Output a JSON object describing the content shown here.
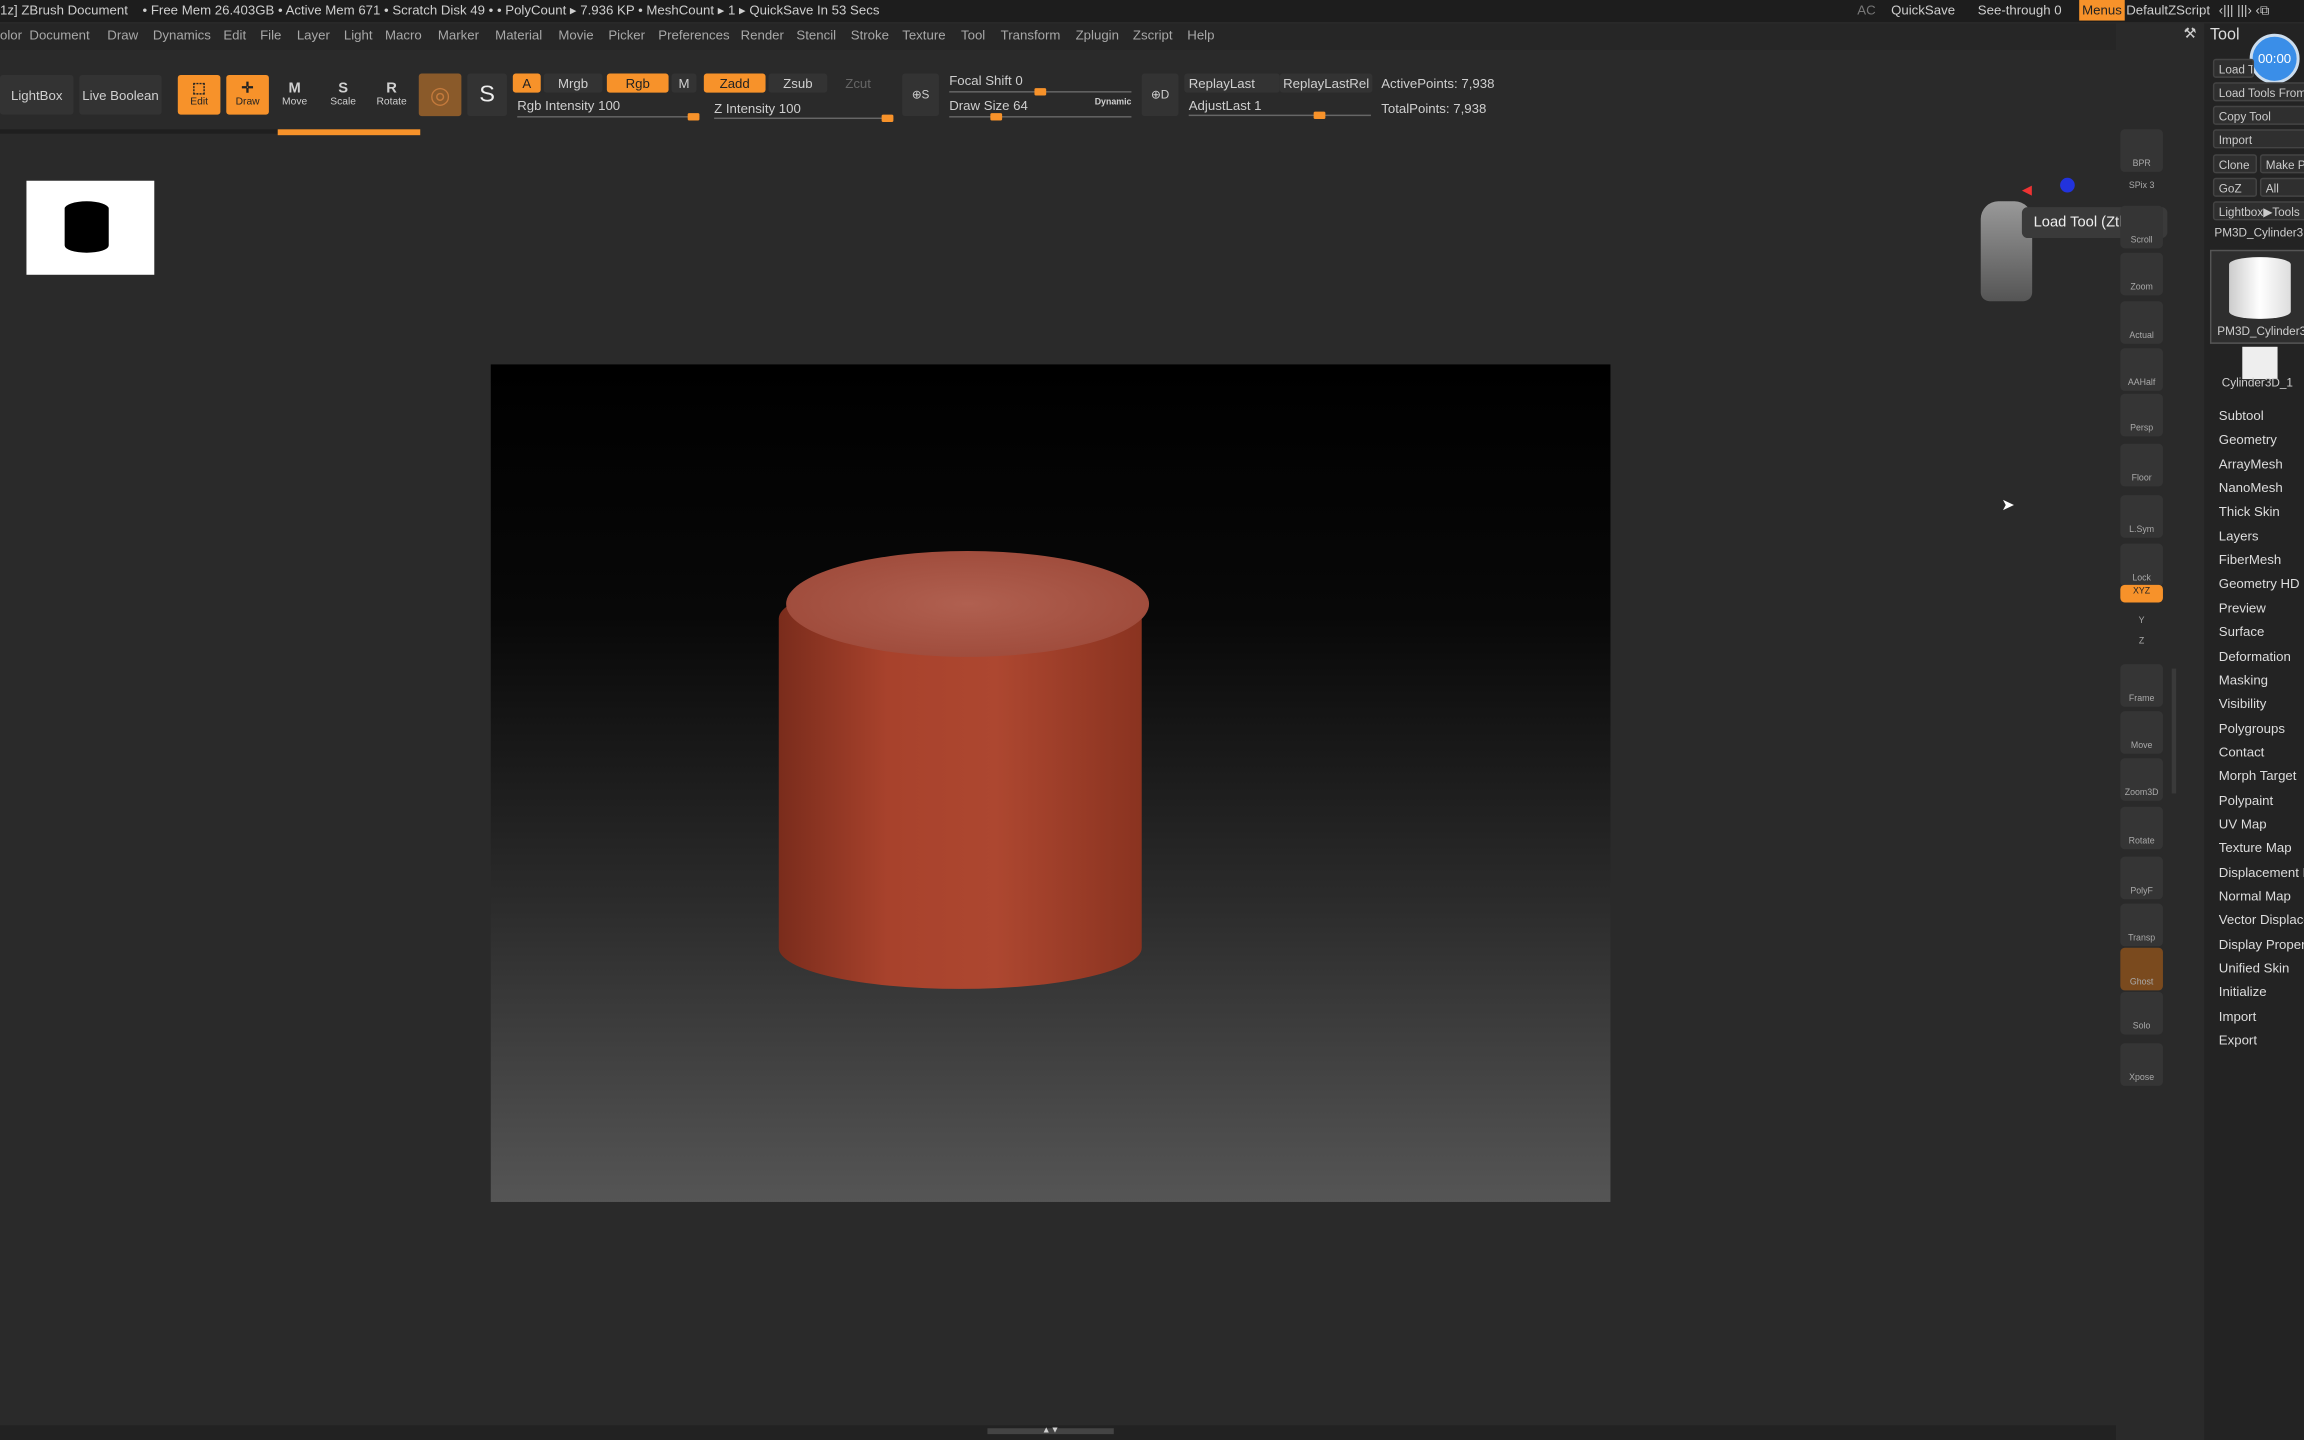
{
  "titlebar": {
    "app": "1z]  ZBrush Document",
    "stats": "• Free Mem 26.403GB • Active Mem 671 • Scratch Disk 49 • • PolyCount ▸ 7.936 KP  • MeshCount ▸ 1  ▸ QuickSave In 53 Secs",
    "ac": "AC",
    "quicksave": "QuickSave",
    "seethrough": "See-through  0",
    "menus": "Menus",
    "zscript": "DefaultZScript"
  },
  "menus": [
    "olor",
    "Document",
    "Draw",
    "Dynamics",
    "Edit",
    "File",
    "Layer",
    "Light",
    "Macro",
    "Marker",
    "Material",
    "Movie",
    "Picker",
    "Preferences",
    "Render",
    "Stencil",
    "Stroke",
    "Texture",
    "Tool",
    "Transform",
    "Zplugin",
    "Zscript",
    "Help"
  ],
  "toolbar": {
    "lightbox": "LightBox",
    "live_boolean": "Live Boolean",
    "edit": "Edit",
    "draw": "Draw",
    "move": "Move",
    "scale": "Scale",
    "rotate": "Rotate",
    "a": "A",
    "mrgb": "Mrgb",
    "rgb": "Rgb",
    "m": "M",
    "zadd": "Zadd",
    "zsub": "Zsub",
    "zcut": "Zcut",
    "rgb_intensity": "Rgb Intensity 100",
    "z_intensity": "Z Intensity 100",
    "focal_shift": "Focal Shift 0",
    "draw_size": "Draw Size 64",
    "dynamic": "Dynamic",
    "replay_last": "ReplayLast",
    "replay_last_rel": "ReplayLastRel",
    "adjust_last": "AdjustLast 1",
    "active_points": "ActivePoints: 7,938",
    "total_points": "TotalPoints: 7,938",
    "s": "S",
    "d": "D"
  },
  "values": {
    "rgb_intensity": 100,
    "z_intensity": 100,
    "focal_shift": 0,
    "draw_size": 64,
    "adjust_last": 1,
    "see_through": 0
  },
  "tooltip": "Load Tool (Ztl File)",
  "shelf": [
    "BPR",
    "SPix 3",
    "Scroll",
    "Zoom",
    "Actual",
    "AAHalf",
    "Persp",
    "Floor",
    "L.Sym",
    "Lock",
    "XYZ",
    "Y",
    "Z",
    "Frame",
    "Move",
    "Zoom3D",
    "Rotate",
    "PolyF",
    "Transp",
    "Ghost",
    "Solo",
    "Xpose"
  ],
  "tool": {
    "title": "Tool",
    "timer": "00:00",
    "load_tool": "Load Tool",
    "load_tools_from": "Load Tools From",
    "copy_tool": "Copy Tool",
    "import": "Import",
    "clone": "Clone",
    "make_p": "Make P",
    "goz": "GoZ",
    "all": "All",
    "lightbox_tools": "Lightbox▶Tools",
    "current": "PM3D_Cylinder3",
    "thumb1": "PM3D_Cylinder3",
    "thumb2": "Cylinder3D_1"
  },
  "sections": [
    "Subtool",
    "Geometry",
    "ArrayMesh",
    "NanoMesh",
    "Thick Skin",
    "Layers",
    "FiberMesh",
    "Geometry HD",
    "Preview",
    "Surface",
    "Deformation",
    "Masking",
    "Visibility",
    "Polygroups",
    "Contact",
    "Morph Target",
    "Polypaint",
    "UV Map",
    "Texture Map",
    "Displacement Map",
    "Normal Map",
    "Vector Displacement",
    "Display Properties",
    "Unified Skin",
    "Initialize",
    "Import",
    "Export"
  ],
  "colors": {
    "accent": "#f7922a",
    "mesh": "#a8422c",
    "timer": "#3a8ee8"
  }
}
